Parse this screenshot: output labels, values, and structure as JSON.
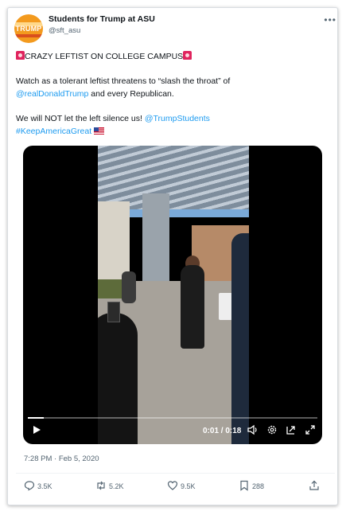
{
  "tweet": {
    "author_name": "Students for Trump at ASU",
    "author_handle": "@sft_asu",
    "avatar_text": "TRUMP",
    "headline": "CRAZY LEFTIST ON COLLEGE CAMPUS",
    "line1_prefix": "Watch as a tolerant leftist threatens to “slash the throat” of",
    "mention_trump": "@realDonaldTrump",
    "line1_suffix": " and every Republican.",
    "line2_prefix": "We will NOT let the left silence us! ",
    "mention_students": "@TrumpStudents",
    "hashtag": "#KeepAmericaGreat",
    "timestamp": "7:28 PM · Feb 5, 2020"
  },
  "video": {
    "time": "0:01 / 0:18",
    "progress": 0.055
  },
  "actions": {
    "replies": "3.5K",
    "retweets": "5.2K",
    "likes": "9.5K",
    "bookmarks": "288"
  },
  "colors": {
    "link": "#1d9bf0",
    "muted": "#536471"
  }
}
